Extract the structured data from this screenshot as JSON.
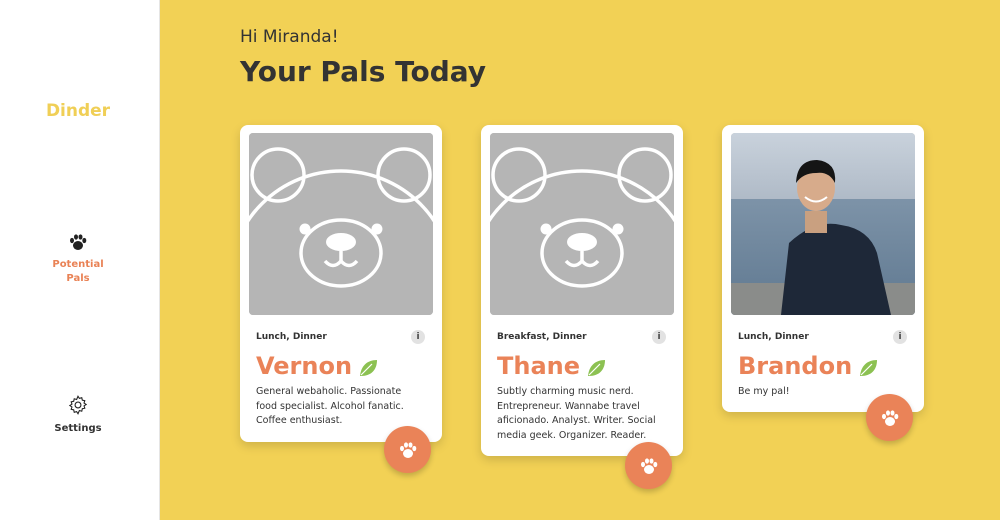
{
  "app": {
    "brand": "Dinder"
  },
  "sidebar": {
    "items": [
      {
        "label_line1": "Potential",
        "label_line2": "Pals",
        "icon": "paw-icon",
        "active": true
      },
      {
        "label": "Settings",
        "icon": "gear-icon",
        "active": false
      }
    ]
  },
  "header": {
    "greeting": "Hi Miranda!",
    "title": "Your Pals Today"
  },
  "cards": [
    {
      "meals": "Lunch, Dinner",
      "name": "Vernon",
      "photo": "bear-placeholder",
      "bio": "General webaholic. Passionate food specialist. Alcohol fanatic. Coffee enthusiast."
    },
    {
      "meals": "Breakfast, Dinner",
      "name": "Thane",
      "photo": "bear-placeholder",
      "bio": "Subtly charming music nerd. Entrepreneur. Wannabe travel aficionado. Analyst. Writer. Social media geek. Organizer. Reader."
    },
    {
      "meals": "Lunch, Dinner",
      "name": "Brandon",
      "photo": "person-photo-lakeside",
      "bio": "Be my pal!"
    }
  ],
  "ui": {
    "info_label": "i"
  },
  "colors": {
    "background": "#f2d155",
    "accent": "#ea8358",
    "brand": "#f0cf56",
    "leaf": "#8cc152",
    "placeholder": "#b5b5b5"
  }
}
